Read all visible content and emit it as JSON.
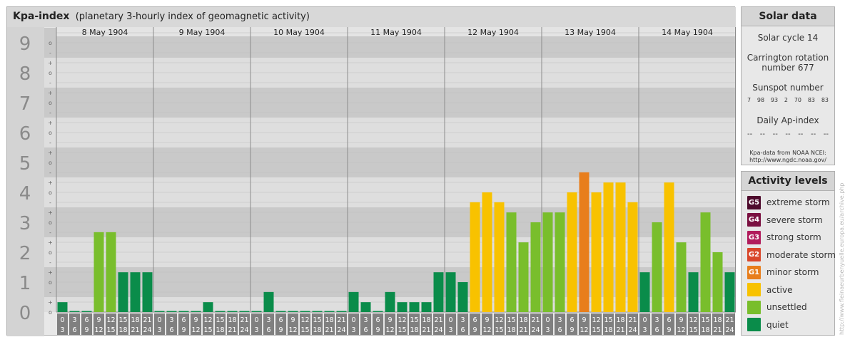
{
  "chart_title": "Kpa-index",
  "chart_subtitle": "(planetary 3-hourly index of geomagnetic activity)",
  "chart_data": {
    "type": "bar",
    "ylim": [
      0,
      9
    ],
    "y_ticks": [
      "0",
      "1",
      "2",
      "3",
      "4",
      "5",
      "6",
      "7",
      "8",
      "9"
    ],
    "y_subticks": [
      "o",
      "+",
      "-",
      "o",
      "+",
      "-",
      "o",
      "+",
      "-",
      "o",
      "+",
      "-",
      "o",
      "+",
      "-",
      "o",
      "+",
      "-",
      "o",
      "+",
      "-",
      "o",
      "+",
      "-",
      "o",
      "+",
      "-",
      "o"
    ],
    "hour_start_labels": [
      "0",
      "3",
      "6",
      "9",
      "12",
      "15",
      "18",
      "21"
    ],
    "hour_end_labels": [
      "3",
      "6",
      "9",
      "12",
      "15",
      "18",
      "21",
      "24"
    ],
    "days": [
      {
        "date": "8 May 1904",
        "values": [
          0.33,
          0,
          0,
          2.67,
          2.67,
          1.33,
          1.33,
          1.33
        ]
      },
      {
        "date": "9 May 1904",
        "values": [
          0,
          0,
          0,
          0,
          0.33,
          0,
          0,
          0
        ]
      },
      {
        "date": "10 May 1904",
        "values": [
          0,
          0.67,
          0,
          0,
          0,
          0,
          0,
          0
        ]
      },
      {
        "date": "11 May 1904",
        "values": [
          0.67,
          0.33,
          0,
          0.67,
          0.33,
          0.33,
          0.33,
          1.33
        ]
      },
      {
        "date": "12 May 1904",
        "values": [
          1.33,
          1.0,
          3.67,
          4.0,
          3.67,
          3.33,
          2.33,
          3.0
        ]
      },
      {
        "date": "13 May 1904",
        "values": [
          3.33,
          3.33,
          4.0,
          4.67,
          4.0,
          4.33,
          4.33,
          3.67
        ]
      },
      {
        "date": "14 May 1904",
        "values": [
          1.33,
          3.0,
          4.33,
          2.33,
          1.33,
          3.33,
          2.0,
          1.33
        ]
      }
    ],
    "colors": {
      "quiet": "#0a8c4a",
      "unsettled": "#79be2c",
      "active": "#f8c200",
      "minor": "#e87e1c",
      "moderate": "#d9472b",
      "strong": "#b11c5c",
      "severe": "#7a1040",
      "extreme": "#4d0a2c"
    }
  },
  "solar": {
    "title": "Solar data",
    "cycle": "Solar cycle 14",
    "carrington_line1": "Carrington rotation",
    "carrington_line2": "number 677",
    "sunspot_title": "Sunspot number",
    "sunspot_values": [
      "7",
      "98",
      "93",
      "2",
      "70",
      "83",
      "83"
    ],
    "ap_title": "Daily Ap-index",
    "ap_values": [
      "--",
      "--",
      "--",
      "--",
      "--",
      "--",
      "--"
    ],
    "source_line1": "Kpa-data from NOAA NCEI:",
    "source_line2": "http://www.ngdc.noaa.gov/"
  },
  "activity": {
    "title": "Activity levels",
    "levels": [
      {
        "badge": "G5",
        "label": "extreme storm",
        "color": "#4d0a2c"
      },
      {
        "badge": "G4",
        "label": "severe storm",
        "color": "#7a1040"
      },
      {
        "badge": "G3",
        "label": "strong storm",
        "color": "#b11c5c"
      },
      {
        "badge": "G2",
        "label": "moderate storm",
        "color": "#d9472b"
      },
      {
        "badge": "G1",
        "label": "minor storm",
        "color": "#e87e1c"
      },
      {
        "badge": "",
        "label": "active",
        "color": "#f8c200"
      },
      {
        "badge": "",
        "label": "unsettled",
        "color": "#79be2c"
      },
      {
        "badge": "",
        "label": "quiet",
        "color": "#0a8c4a"
      }
    ]
  },
  "watermark": "http://www.fleinaeurbenyuelle.europa.eu/archive.php"
}
